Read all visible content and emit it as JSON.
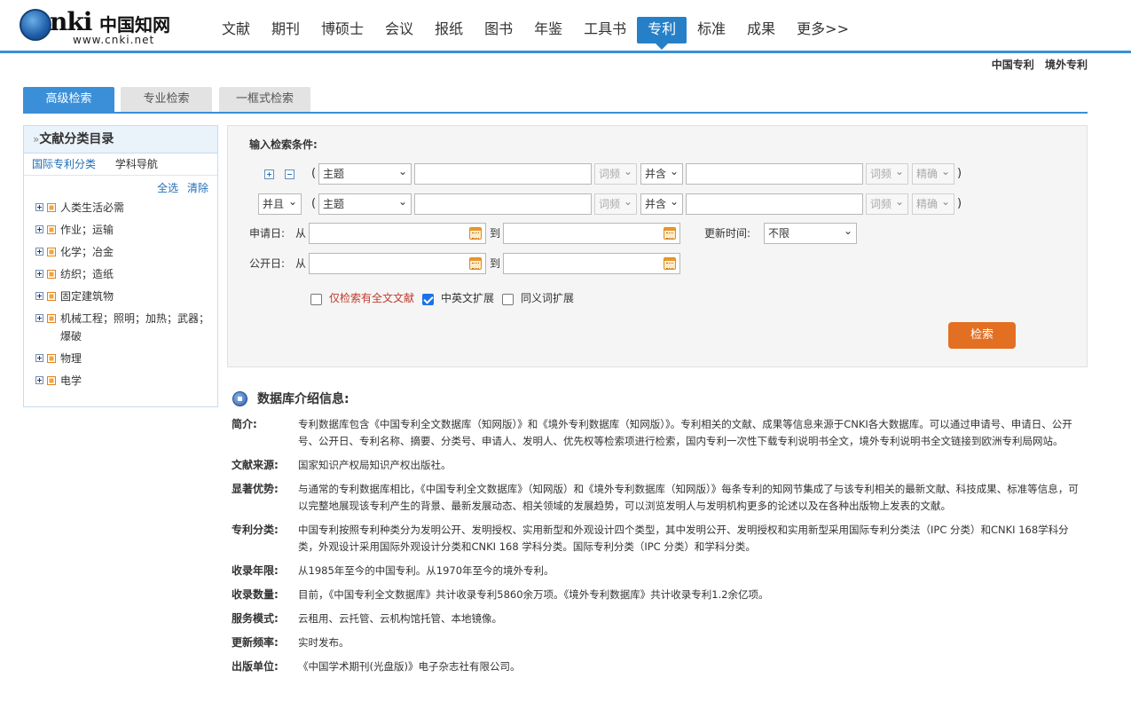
{
  "logo": {
    "cn": "中国知网",
    "url": "www.cnki.net"
  },
  "nav": [
    "文献",
    "期刊",
    "博硕士",
    "会议",
    "报纸",
    "图书",
    "年鉴",
    "工具书",
    "专利",
    "标准",
    "成果",
    "更多>>"
  ],
  "nav_active_index": 8,
  "sub_links": [
    "中国专利",
    "境外专利"
  ],
  "tabs": [
    "高级检索",
    "专业检索",
    "一框式检索"
  ],
  "sidebar": {
    "title": "文献分类目录",
    "tab_ipc": "国际专利分类",
    "tab_subject": "学科导航",
    "select_all": "全选",
    "clear": "清除",
    "items": [
      "人类生活必需",
      "作业；运输",
      "化学；冶金",
      "纺织；造纸",
      "固定建筑物",
      "机械工程；照明；加热；武器；爆破",
      "物理",
      "电学"
    ]
  },
  "search": {
    "title": "输入检索条件:",
    "row1": {
      "field": "主题",
      "freq1": "词频",
      "combine": "并含",
      "freq2": "词频",
      "match": "精确"
    },
    "row2": {
      "logic": "并且",
      "field": "主题",
      "freq1": "词频",
      "combine": "并含",
      "freq2": "词频",
      "match": "精确"
    },
    "apply_date_label": "申请日:",
    "pub_date_label": "公开日:",
    "from": "从",
    "to": "到",
    "update_time_label": "更新时间:",
    "update_time_value": "不限",
    "cb_fulltext": "仅检索有全文文献",
    "cb_cn_en": "中英文扩展",
    "cb_synonym": "同义词扩展",
    "button": "检索"
  },
  "db_info": {
    "title": "数据库介绍信息:",
    "rows": [
      {
        "label": "简介:",
        "text": "专利数据库包含《中国专利全文数据库（知网版）》和《境外专利数据库（知网版）》。专利相关的文献、成果等信息来源于CNKI各大数据库。可以通过申请号、申请日、公开号、公开日、专利名称、摘要、分类号、申请人、发明人、优先权等检索项进行检索，国内专利一次性下载专利说明书全文，境外专利说明书全文链接到欧洲专利局网站。"
      },
      {
        "label": "文献来源:",
        "text": "国家知识产权局知识产权出版社。"
      },
      {
        "label": "显著优势:",
        "text": "与通常的专利数据库相比，《中国专利全文数据库》（知网版）和《境外专利数据库（知网版）》每条专利的知网节集成了与该专利相关的最新文献、科技成果、标准等信息，可以完整地展现该专利产生的背景、最新发展动态、相关领域的发展趋势，可以浏览发明人与发明机构更多的论述以及在各种出版物上发表的文献。"
      },
      {
        "label": "专利分类:",
        "text": "中国专利按照专利种类分为发明公开、发明授权、实用新型和外观设计四个类型，其中发明公开、发明授权和实用新型采用国际专利分类法（IPC 分类）和CNKI 168学科分类，外观设计采用国际外观设计分类和CNKI 168 学科分类。国际专利分类（IPC 分类）和学科分类。"
      },
      {
        "label": "收录年限:",
        "text": "从1985年至今的中国专利。从1970年至今的境外专利。"
      },
      {
        "label": "收录数量:",
        "text": "目前，《中国专利全文数据库》共计收录专利5860余万项。《境外专利数据库》共计收录专利1.2余亿项。"
      },
      {
        "label": "服务模式:",
        "text": "云租用、云托管、云机构馆托管、本地镜像。"
      },
      {
        "label": "更新频率:",
        "text": "实时发布。"
      },
      {
        "label": "出版单位:",
        "text": "《中国学术期刊(光盘版)》电子杂志社有限公司。"
      }
    ]
  }
}
